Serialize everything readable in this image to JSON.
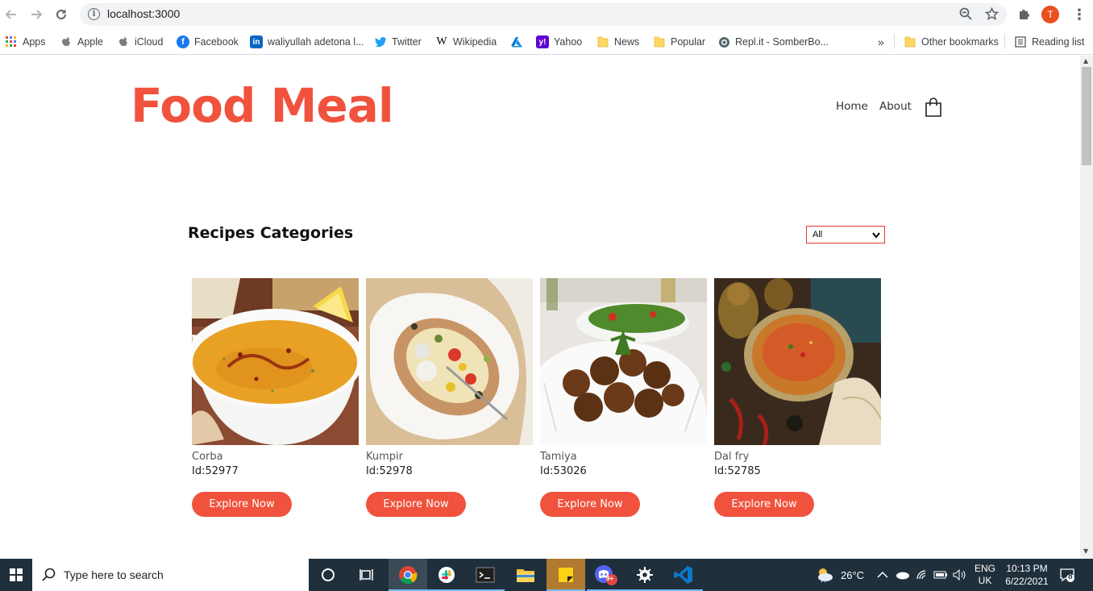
{
  "browser": {
    "url": "localhost:3000",
    "profile_initial": "T",
    "bookmarks": [
      {
        "label": "Apps",
        "icon": "apps-grid-icon"
      },
      {
        "label": "Apple",
        "icon": "apple-icon"
      },
      {
        "label": "iCloud",
        "icon": "apple-icon"
      },
      {
        "label": "Facebook",
        "icon": "facebook-icon"
      },
      {
        "label": "waliyullah adetona l...",
        "icon": "linkedin-icon"
      },
      {
        "label": "Twitter",
        "icon": "twitter-icon"
      },
      {
        "label": "Wikipedia",
        "icon": "wikipedia-icon"
      },
      {
        "label": "",
        "icon": "azure-icon"
      },
      {
        "label": "Yahoo",
        "icon": "yahoo-icon"
      },
      {
        "label": "News",
        "icon": "folder-icon"
      },
      {
        "label": "Popular",
        "icon": "folder-icon"
      },
      {
        "label": "Repl.it - SomberBo...",
        "icon": "replit-icon"
      }
    ],
    "overflow_label": "»",
    "other_bookmarks": "Other bookmarks",
    "reading_list": "Reading list"
  },
  "site": {
    "brand": "Food Meal",
    "nav": [
      {
        "label": "Home"
      },
      {
        "label": "About"
      }
    ],
    "section_title": "Recipes Categories",
    "filter": {
      "selected": "All"
    },
    "accent_color": "#f0523d",
    "meals": [
      {
        "name": "Corba",
        "id": "Id:52977",
        "button": "Explore Now"
      },
      {
        "name": "Kumpir",
        "id": "Id:52978",
        "button": "Explore Now"
      },
      {
        "name": "Tamiya",
        "id": "Id:53026",
        "button": "Explore Now"
      },
      {
        "name": "Dal fry",
        "id": "Id:52785",
        "button": "Explore Now"
      }
    ]
  },
  "taskbar": {
    "search_placeholder": "Type here to search",
    "weather": "26°C",
    "lang_line1": "ENG",
    "lang_line2": "UK",
    "time": "10:13 PM",
    "date": "6/22/2021",
    "notification_count": "8",
    "discord_badge": "9+"
  }
}
